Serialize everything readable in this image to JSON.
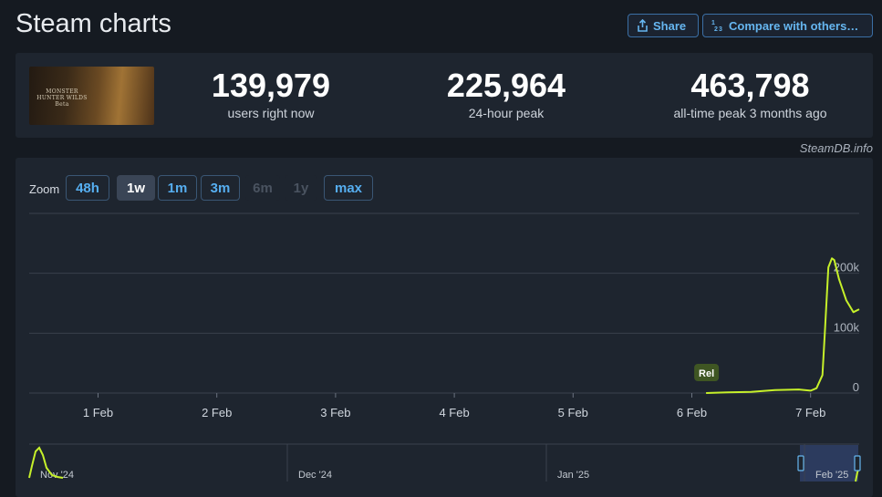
{
  "page": {
    "title": "Steam charts"
  },
  "header_buttons": {
    "share_label": "Share",
    "compare_label": "Compare with others…"
  },
  "game": {
    "cover_text": "MONSTER HUNTER WILDS Beta"
  },
  "stats": [
    {
      "value": "139,979",
      "label": "users right now"
    },
    {
      "value": "225,964",
      "label": "24-hour peak"
    },
    {
      "value": "463,798",
      "label": "all-time peak 3 months ago"
    }
  ],
  "credit": "SteamDB.info",
  "zoom": {
    "label": "Zoom",
    "options": [
      {
        "label": "48h",
        "state": "normal"
      },
      {
        "label": "1w",
        "state": "active"
      },
      {
        "label": "1m",
        "state": "normal"
      },
      {
        "label": "3m",
        "state": "normal"
      },
      {
        "label": "6m",
        "state": "disabled"
      },
      {
        "label": "1y",
        "state": "disabled"
      },
      {
        "label": "max",
        "state": "normal"
      }
    ]
  },
  "colors": {
    "line": "#c6f02a",
    "accent": "#66b6f0",
    "grid": "#3a414d",
    "marker_bg": "#3f5623"
  },
  "chart_data": {
    "type": "line",
    "title": "",
    "xlabel": "",
    "ylabel": "",
    "x_ticks": [
      "1 Feb",
      "2 Feb",
      "3 Feb",
      "4 Feb",
      "5 Feb",
      "6 Feb",
      "7 Feb"
    ],
    "y_ticks": [
      "0",
      "100k",
      "200k"
    ],
    "ylim": [
      0,
      300000
    ],
    "grid": true,
    "series": [
      {
        "x": [
          5.12,
          5.3,
          5.5,
          5.7,
          5.9,
          6.0,
          6.05,
          6.1,
          6.12,
          6.15,
          6.18,
          6.2,
          6.24,
          6.3,
          6.36,
          6.42
        ],
        "values": [
          0,
          1000,
          2000,
          5000,
          6000,
          4000,
          8000,
          30000,
          100000,
          210000,
          225000,
          222000,
          190000,
          155000,
          135000,
          139979
        ]
      }
    ],
    "annotations": [
      {
        "x": 5.12,
        "label": "Rel"
      }
    ],
    "navigator": {
      "labels": [
        "Nov '24",
        "Dec '24",
        "Jan '25",
        "Feb '25"
      ]
    }
  }
}
